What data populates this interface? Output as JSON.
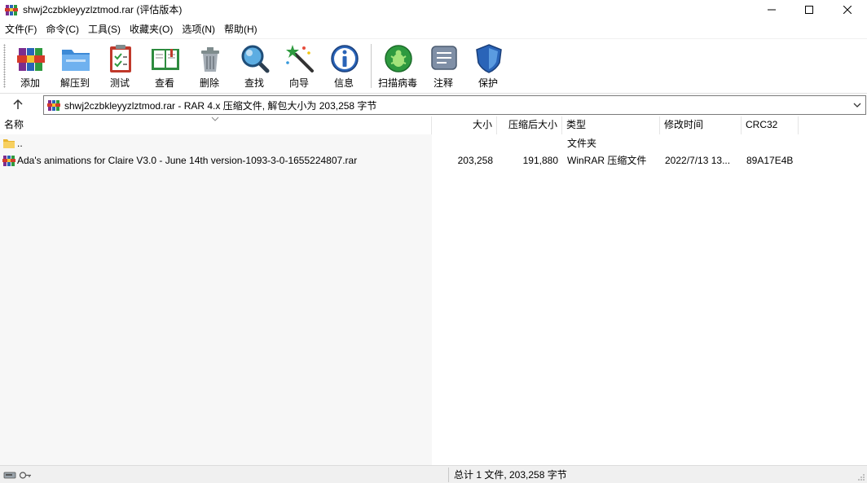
{
  "window": {
    "title": "shwj2czbkleyyzlztmod.rar (评估版本)"
  },
  "menu": [
    {
      "label": "文件(F)"
    },
    {
      "label": "命令(C)"
    },
    {
      "label": "工具(S)"
    },
    {
      "label": "收藏夹(O)"
    },
    {
      "label": "选项(N)"
    },
    {
      "label": "帮助(H)"
    }
  ],
  "toolbar": {
    "add": "添加",
    "extract": "解压到",
    "test": "测试",
    "view": "查看",
    "delete": "删除",
    "find": "查找",
    "wizard": "向导",
    "info": "信息",
    "scan": "扫描病毒",
    "comment": "注释",
    "protect": "保护"
  },
  "address": {
    "text": "shwj2czbkleyyzlztmod.rar - RAR 4.x 压缩文件, 解包大小为 203,258 字节"
  },
  "columns": {
    "name": "名称",
    "size": "大小",
    "packed": "压缩后大小",
    "type": "类型",
    "modified": "修改时间",
    "crc": "CRC32"
  },
  "rows": [
    {
      "name": "..",
      "size": "",
      "packed": "",
      "type": "文件夹",
      "modified": "",
      "crc": "",
      "icon": "folder-icon"
    },
    {
      "name": "Ada's animations for Claire V3.0 - June 14th version-1093-3-0-1655224807.rar",
      "size": "203,258",
      "packed": "191,880",
      "type": "WinRAR 压缩文件",
      "modified": "2022/7/13 13...",
      "crc": "89A17E4B",
      "icon": "rar-file-icon"
    }
  ],
  "status": {
    "summary": "总计 1 文件, 203,258 字节"
  },
  "colors": {
    "window_bg": "#ffffff",
    "statusbar_bg": "#f0f0f0",
    "name_column_bg": "#f7f7f7"
  }
}
